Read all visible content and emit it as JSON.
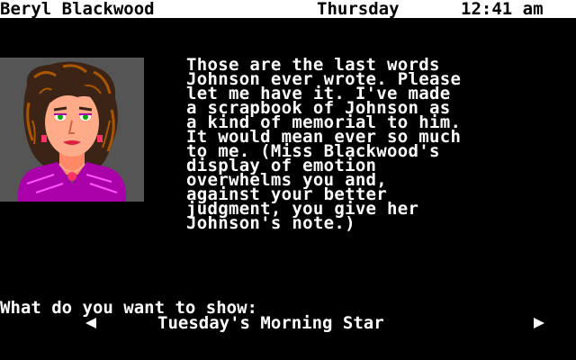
{
  "status": {
    "character_name": "Beryl Blackwood",
    "day": "Thursday",
    "time": "12:41 am"
  },
  "portrait": {
    "subject": "Beryl Blackwood",
    "background_color": "#555555",
    "blouse_color": "#aa00aa"
  },
  "narration": "Those are the last words\nJohnson ever wrote. Please\nlet me have it. I've made\na scrapbook of Johnson as\na kind of memorial to him.\nIt would mean ever so much\nto me. (Miss Blackwood's\ndisplay of emotion\noverwhelms you and,\nagainst your better\njudgment, you give her\nJohnson's note.)",
  "prompt": {
    "question": "What do you want to show:",
    "selected_item": "Tuesday's Morning Star",
    "left_icon": "arrow-left-icon",
    "right_icon": "arrow-right-icon"
  }
}
